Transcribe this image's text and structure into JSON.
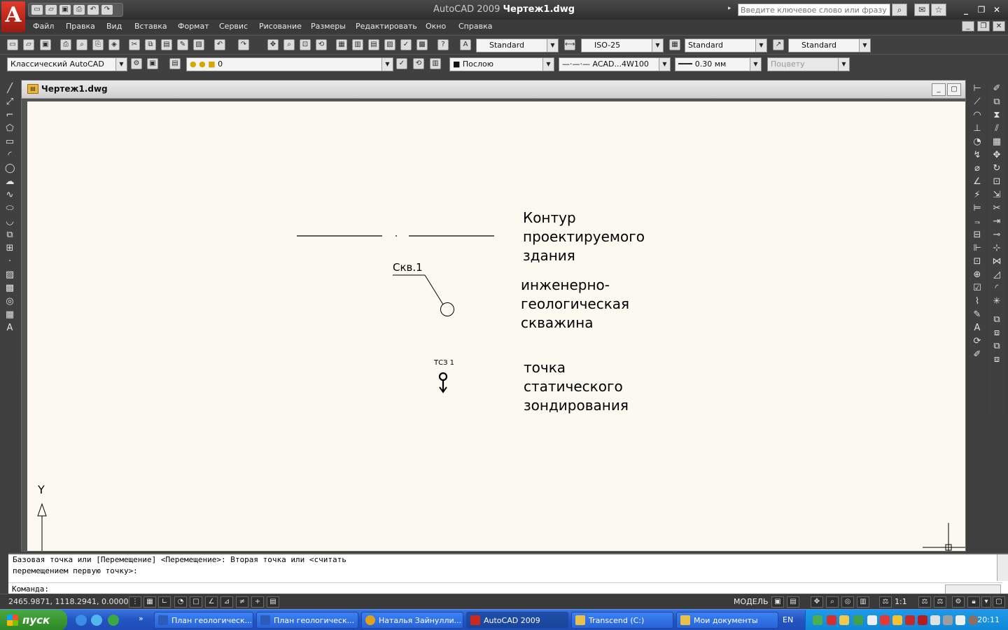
{
  "window": {
    "app_name": "AutoCAD 2009",
    "doc_name": "Чертеж1.dwg",
    "search_placeholder": "Введите ключевое слово или фразу"
  },
  "menu": [
    {
      "label": "Файл"
    },
    {
      "label": "Правка"
    },
    {
      "label": "Вид"
    },
    {
      "label": "Вставка"
    },
    {
      "label": "Формат"
    },
    {
      "label": "Сервис"
    },
    {
      "label": "Рисование"
    },
    {
      "label": "Размеры"
    },
    {
      "label": "Редактировать"
    },
    {
      "label": "Окно"
    },
    {
      "label": "Справка"
    }
  ],
  "styles_toolbar": {
    "text_style": "Standard",
    "dim_style": "ISO-25",
    "table_style": "Standard",
    "mleader_style": "Standard"
  },
  "layers_toolbar": {
    "workspace": "Классический AutoCAD",
    "layer": "0",
    "color": "Послою",
    "linetype": "ACAD...4W100",
    "lineweight": "0.30 мм",
    "plotstyle": "Поцвету"
  },
  "drawing": {
    "legend": {
      "contour": [
        "Контур",
        "проектируемого",
        "здания"
      ],
      "borehole": [
        "инженерно-",
        "геологическая",
        "скважина"
      ],
      "sounding": [
        "точка",
        "статического",
        "зондирования"
      ]
    },
    "borehole_label": "Скв.1",
    "sounding_label": "ТСЗ 1",
    "ucs_y": "Y"
  },
  "command": {
    "history": [
      "Базовая точка или [Перемещение] <Перемещение>: Вторая точка или <считать",
      "перемещением первую точку>:"
    ],
    "prompt": "Команда:"
  },
  "status": {
    "coords": "2465.9871, 1118.2941, 0.0000",
    "model": "МОДЕЛЬ",
    "scale": "1:1"
  },
  "taskbar": {
    "start": "пуск",
    "tasks": [
      {
        "label": "План геологическ...",
        "color": "#2b5cb8"
      },
      {
        "label": "План геологическ...",
        "color": "#2b5cb8"
      },
      {
        "label": "Наталья Зайнулли...",
        "color": "#e0a11b"
      },
      {
        "label": "AutoCAD 2009",
        "color": "#c92a1d"
      },
      {
        "label": "Transcend (C:)",
        "color": "#e8c04a"
      },
      {
        "label": "Мои документы",
        "color": "#e8c04a"
      }
    ],
    "lang": "EN",
    "clock": "20:11"
  },
  "colors": {
    "canvas_bg": "#fcfaf0",
    "ui_dark": "#3f3f3f",
    "taskbar_blue": "#2456c4",
    "start_green": "#2c8726"
  }
}
